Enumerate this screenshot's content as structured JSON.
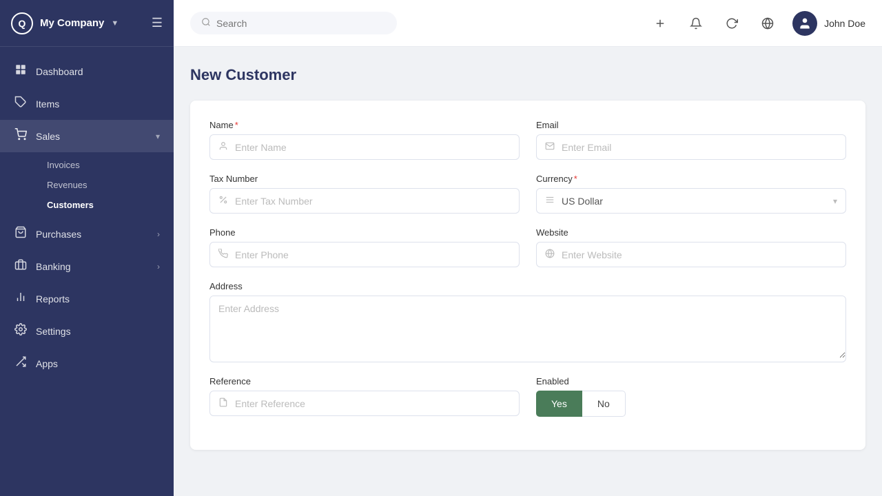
{
  "brand": {
    "logo": "Q",
    "company": "My Company",
    "chevron": "▼"
  },
  "sidebar": {
    "items": [
      {
        "id": "dashboard",
        "label": "Dashboard",
        "icon": "⊞",
        "active": false
      },
      {
        "id": "items",
        "label": "Items",
        "icon": "🏷",
        "active": false
      },
      {
        "id": "sales",
        "label": "Sales",
        "icon": "🛒",
        "active": true,
        "hasChevron": true
      },
      {
        "id": "purchases",
        "label": "Purchases",
        "icon": "🛍",
        "active": false,
        "hasChevron": true
      },
      {
        "id": "banking",
        "label": "Banking",
        "icon": "💼",
        "active": false,
        "hasChevron": true
      },
      {
        "id": "reports",
        "label": "Reports",
        "icon": "📊",
        "active": false
      },
      {
        "id": "settings",
        "label": "Settings",
        "icon": "⚙",
        "active": false
      },
      {
        "id": "apps",
        "label": "Apps",
        "icon": "🔌",
        "active": false
      }
    ],
    "subnav": [
      {
        "id": "invoices",
        "label": "Invoices",
        "active": false
      },
      {
        "id": "revenues",
        "label": "Revenues",
        "active": false
      },
      {
        "id": "customers",
        "label": "Customers",
        "active": true
      }
    ]
  },
  "topbar": {
    "search_placeholder": "Search",
    "user_name": "John Doe"
  },
  "page": {
    "title": "New Customer"
  },
  "form": {
    "name_label": "Name",
    "name_placeholder": "Enter Name",
    "email_label": "Email",
    "email_placeholder": "Enter Email",
    "tax_label": "Tax Number",
    "tax_placeholder": "Enter Tax Number",
    "currency_label": "Currency",
    "currency_value": "US Dollar",
    "phone_label": "Phone",
    "phone_placeholder": "Enter Phone",
    "website_label": "Website",
    "website_placeholder": "Enter Website",
    "address_label": "Address",
    "address_placeholder": "Enter Address",
    "reference_label": "Reference",
    "reference_placeholder": "Enter Reference",
    "enabled_label": "Enabled",
    "yes_label": "Yes",
    "no_label": "No"
  }
}
